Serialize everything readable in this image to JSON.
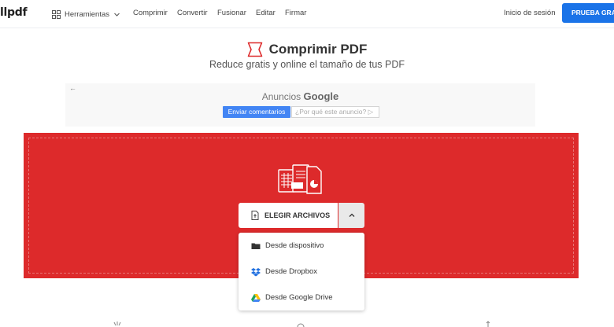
{
  "nav": {
    "logo": "llpdf",
    "tools_label": "Herramientas",
    "links": [
      "Comprimir",
      "Convertir",
      "Fusionar",
      "Editar",
      "Firmar"
    ],
    "login": "Inicio de sesión",
    "trial": "PRUEBA GRATIS",
    "trial_color": "#1a73e8"
  },
  "hero": {
    "title": "Comprimir PDF",
    "subtitle": "Reduce gratis y online el tamaño de tus PDF",
    "icon": "compress-icon",
    "accent": "#dd2a2b"
  },
  "ad": {
    "back": "←",
    "label_prefix": "Anuncios",
    "label_brand": "Google",
    "send_feedback": "Enviar comentarios",
    "why_ad": "¿Por qué este anuncio? ▷"
  },
  "upload": {
    "choose_label": "ELEGIR ARCHIVOS",
    "dropzone_color": "#dd2a2b",
    "menu": [
      {
        "label": "Desde dispositivo",
        "icon": "folder-icon"
      },
      {
        "label": "Desde Dropbox",
        "icon": "dropbox-icon"
      },
      {
        "label": "Desde Google Drive",
        "icon": "google-drive-icon"
      }
    ]
  }
}
